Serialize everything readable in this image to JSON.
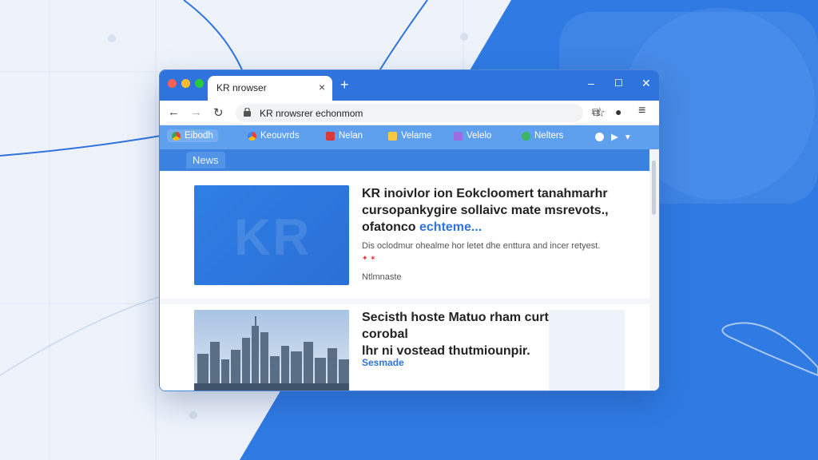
{
  "window": {
    "tab_title": "KR nrowser",
    "close_glyph": "×",
    "newtab_glyph": "+",
    "controls": [
      "–",
      "☐",
      "✕"
    ]
  },
  "toolbar": {
    "back": "←",
    "forward": "→",
    "reload": "↻",
    "url": "KR nrowsrer echonmom",
    "star": "☆",
    "icons": [
      "⧉",
      "●",
      "≡"
    ]
  },
  "bookmarks": [
    {
      "label": "Eibodh",
      "color": "#ffffff"
    },
    {
      "label": "Keouvrds",
      "color": "#f2b233"
    },
    {
      "label": "Nelan",
      "color": "#d83a3a"
    },
    {
      "label": "Velame",
      "color": "#f6c844"
    },
    {
      "label": "Velelo",
      "color": "#9b6de0"
    },
    {
      "label": "Nelters",
      "color": "#3bb662"
    }
  ],
  "bookmark_extra": [
    "▶",
    "▾"
  ],
  "news_tab": "News",
  "article1": {
    "title_line1": "KR inoivlor ion Eokcloomert tanahmarhr",
    "title_line2": "cursopankygire sollaivc mate msrevots.,",
    "title_line3a": "ofatonco ",
    "title_line3b": "echteme...",
    "summary": "Dis oclodmur ohealme hor letet dhe enttura and incer retyest.",
    "emoji": "✦ ✶",
    "meta": "Ntlmnaste"
  },
  "article2": {
    "title_line1": "Secisth hoste Matuo rham curtidao io, corobal",
    "title_line2": "lhr ni vostead thutmiounpir.",
    "tag": "Sesmade"
  },
  "thumb1_text": "KR"
}
